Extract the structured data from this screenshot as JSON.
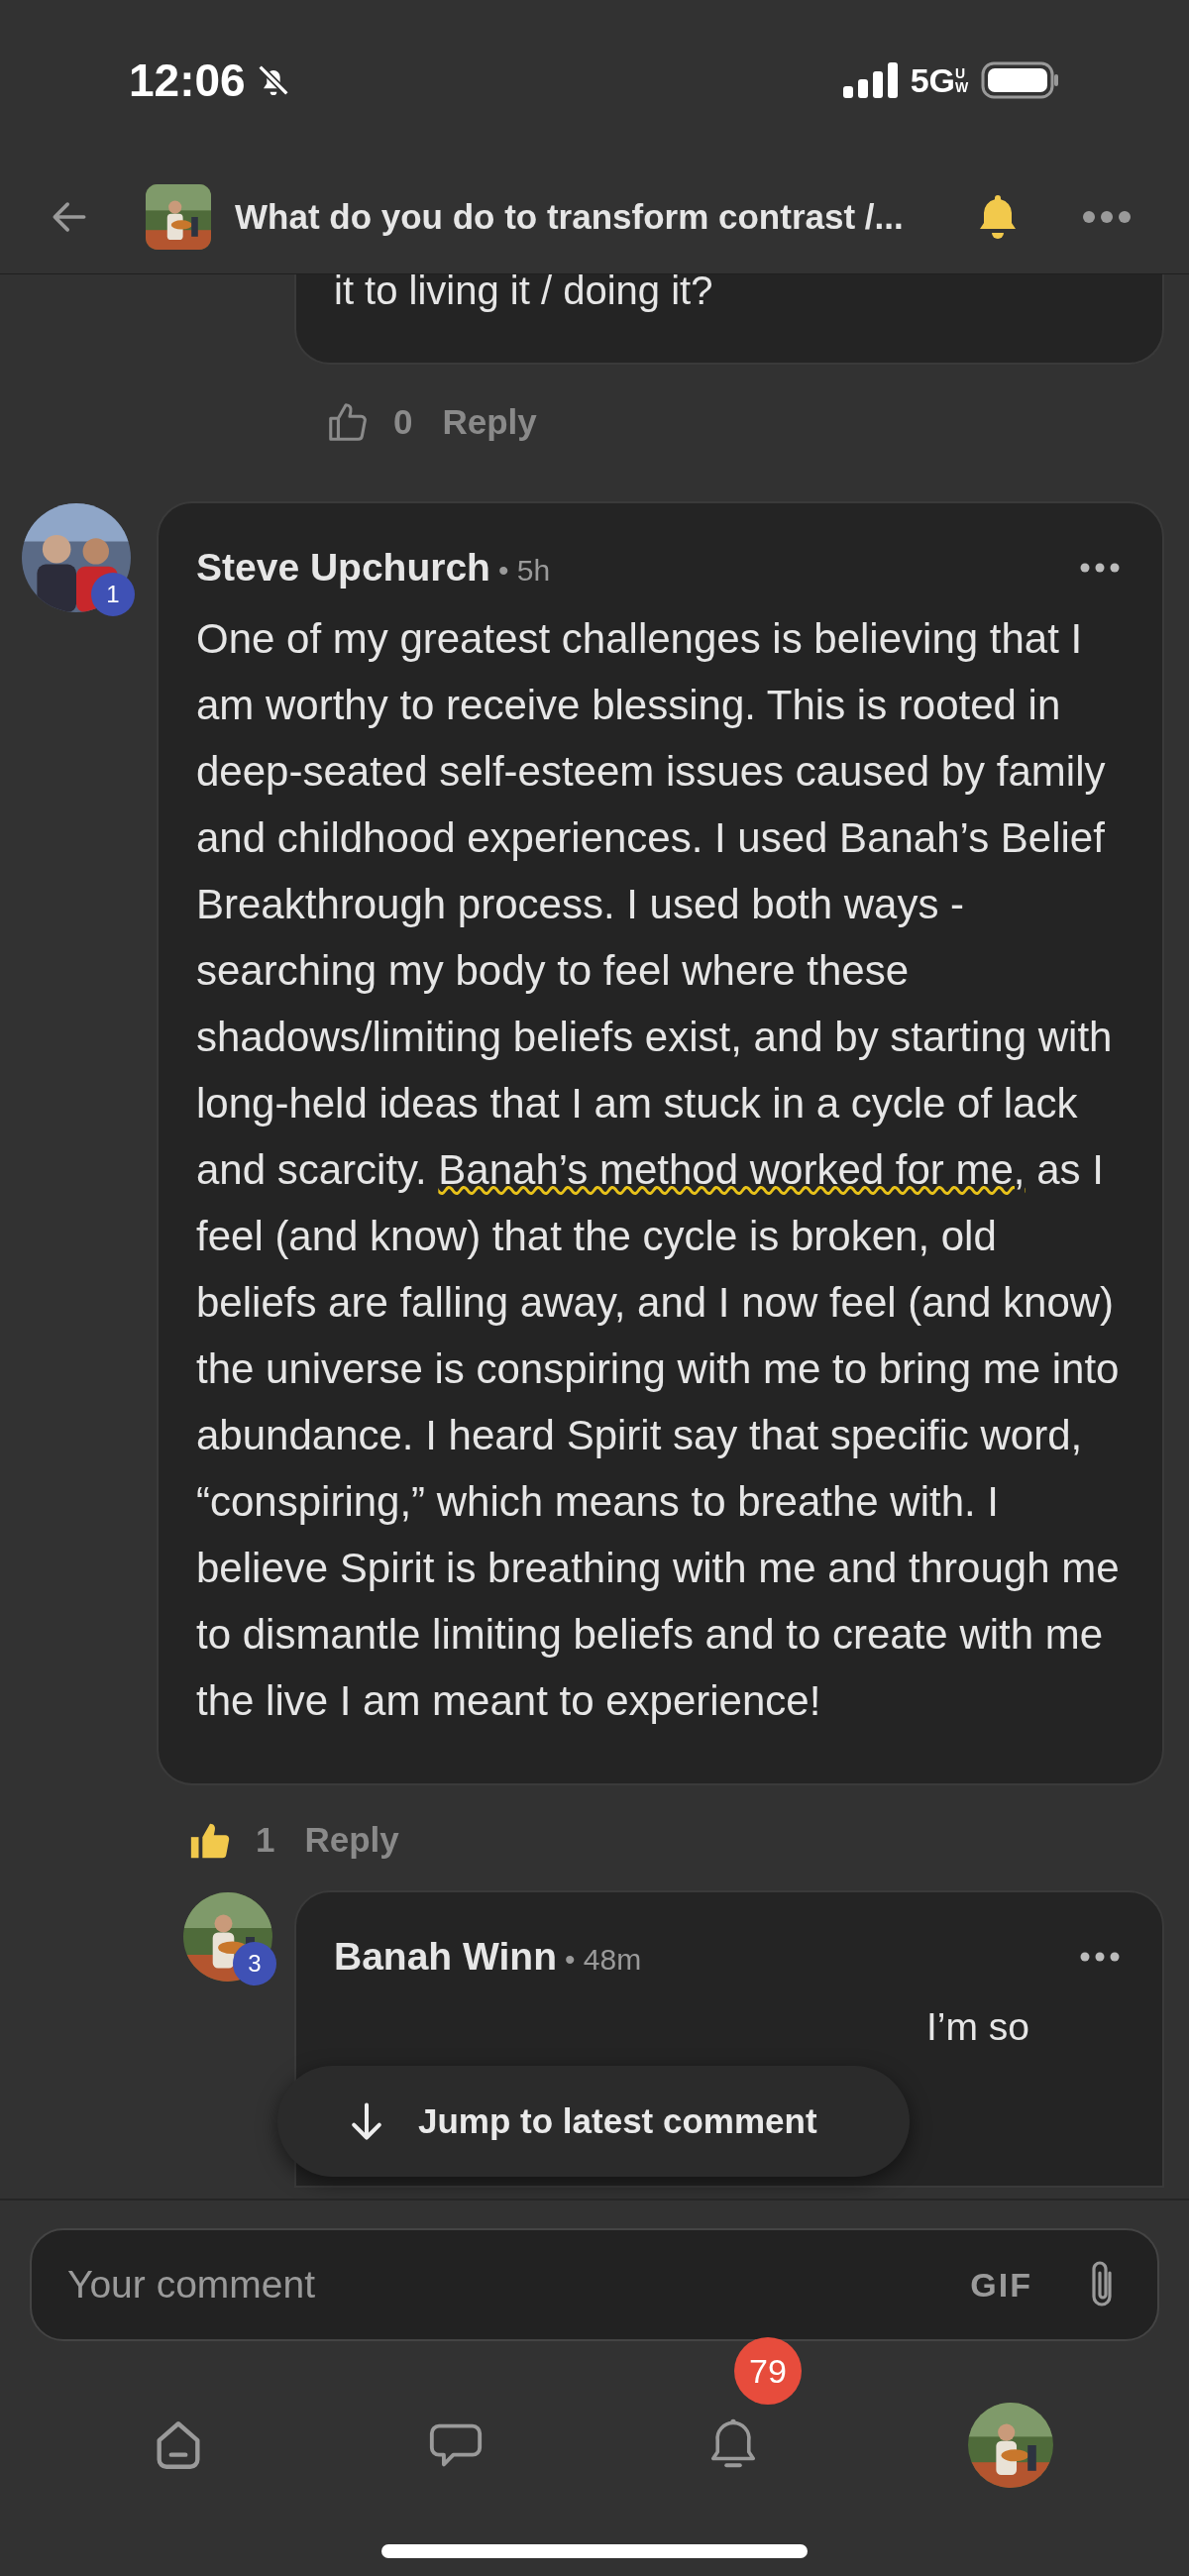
{
  "status_bar": {
    "time": "12:06",
    "silent": true,
    "network": "5G",
    "network_suffix": "UW"
  },
  "header": {
    "title": "What do you do to transform contrast /...",
    "subscribed": true
  },
  "previous_comment": {
    "text": "it to living it / doing it?",
    "liked": false,
    "likes": "0",
    "reply": "Reply"
  },
  "comment": {
    "author": "Steve Upchurch",
    "time": "• 5h",
    "badge": "1",
    "segments": [
      {
        "text": "One of my greatest challenges is believing that I am worthy to receive blessing. This is rooted in deep-seated self-esteem issues caused by family and childhood experiences. I used Banah’s Belief Breakthrough process. I used both ways - searching my body to feel where these shadows/limiting beliefs exist, and by starting with long-held ideas that I am stuck in a cycle of lack and scarcity. ",
        "highlighted": false
      },
      {
        "text": "Banah’s method worked for me,",
        "highlighted": true
      },
      {
        "text": " as I feel (and know) that the cycle is broken, old beliefs are falling away, and I now feel (and know) the universe is conspiring with me to bring me into abundance. I heard Spirit say that specific word, “conspiring,” which means to breathe with. I believe Spirit is breathing with me and through me to dismantle limiting beliefs and to create with me the live I am meant to experience!",
        "highlighted": false
      }
    ],
    "liked": true,
    "likes": "1",
    "reply": "Reply"
  },
  "reply": {
    "author": "Banah Winn",
    "time": "• 48m",
    "badge": "3",
    "text": "I’m so"
  },
  "jump_button": "Jump to latest comment",
  "composer": {
    "placeholder": "Your comment",
    "gif": "GIF"
  },
  "nav": [
    {
      "kind": "home",
      "selected": false
    },
    {
      "kind": "chat",
      "selected": false
    },
    {
      "kind": "bell",
      "selected": false,
      "badge": "79"
    },
    {
      "kind": "avatar",
      "selected": false
    }
  ]
}
